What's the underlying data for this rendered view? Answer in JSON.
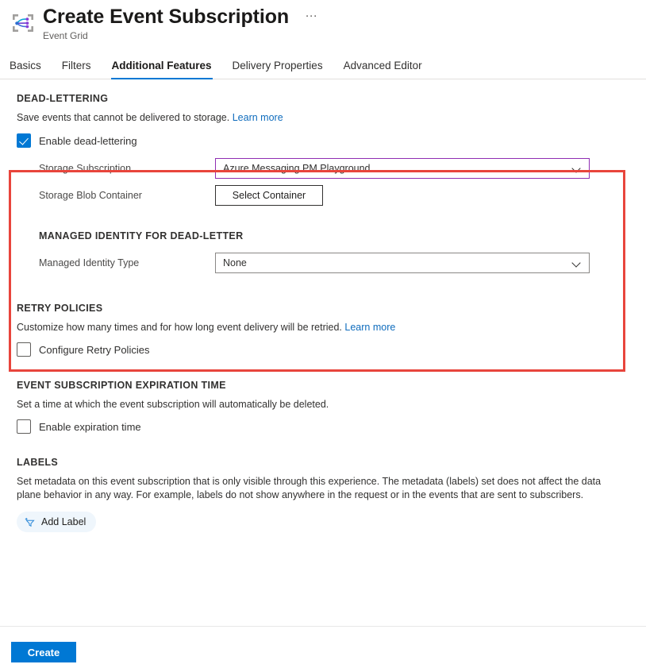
{
  "header": {
    "icon": "event-grid-icon",
    "title": "Create Event Subscription",
    "subtitle": "Event Grid",
    "more_label": "…"
  },
  "tabs": [
    {
      "label": "Basics",
      "active": false
    },
    {
      "label": "Filters",
      "active": false
    },
    {
      "label": "Additional Features",
      "active": true
    },
    {
      "label": "Delivery Properties",
      "active": false
    },
    {
      "label": "Advanced Editor",
      "active": false
    }
  ],
  "dead_lettering": {
    "section_title": "DEAD-LETTERING",
    "description": "Save events that cannot be delivered to storage.",
    "learn_more": "Learn more",
    "enable_label": "Enable dead-lettering",
    "enable_checked": true,
    "storage_subscription": {
      "label": "Storage Subscription",
      "value": "Azure Messaging PM Playground",
      "focused": true,
      "border_color": "#8f2eb3"
    },
    "storage_blob_container": {
      "label": "Storage Blob Container",
      "button_label": "Select Container"
    },
    "managed_identity": {
      "section_title": "MANAGED IDENTITY FOR DEAD-LETTER",
      "label": "Managed Identity Type",
      "value": "None"
    },
    "highlight_color": "#e8453c"
  },
  "retry_policies": {
    "section_title": "RETRY POLICIES",
    "description": "Customize how many times and for how long event delivery will be retried.",
    "learn_more": "Learn more",
    "checkbox_label": "Configure Retry Policies",
    "checked": false
  },
  "expiration": {
    "section_title": "EVENT SUBSCRIPTION EXPIRATION TIME",
    "description": "Set a time at which the event subscription will automatically be deleted.",
    "checkbox_label": "Enable expiration time",
    "checked": false
  },
  "labels": {
    "section_title": "LABELS",
    "description": "Set metadata on this event subscription that is only visible through this experience. The metadata (labels) set does not affect the data plane behavior in any way. For example, labels do not show anywhere in the request or in the events that are sent to subscribers.",
    "add_label_button": "Add Label",
    "add_label_icon": "add-filter-icon"
  },
  "footer": {
    "create_label": "Create",
    "accent_color": "#0078d4"
  }
}
